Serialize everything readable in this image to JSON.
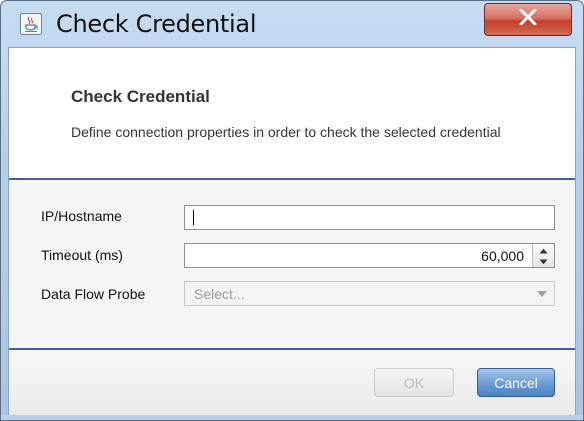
{
  "window": {
    "title": "Check Credential",
    "close_symbol": "X"
  },
  "header": {
    "title": "Check Credential",
    "description": "Define connection properties in order to check the selected credential"
  },
  "form": {
    "ip_label": "IP/Hostname",
    "ip_value": "",
    "timeout_label": "Timeout (ms)",
    "timeout_value": "60,000",
    "probe_label": "Data Flow Probe",
    "probe_placeholder": "Select..."
  },
  "buttons": {
    "ok_label": "OK",
    "ok_enabled": false,
    "cancel_label": "Cancel"
  },
  "icons": {
    "title_icon": "java-cup-icon",
    "close_icon": "close-icon",
    "spin_up_icon": "arrow-up-icon",
    "spin_down_icon": "arrow-down-icon",
    "dropdown_icon": "chevron-down-icon"
  },
  "colors": {
    "title_bar": "#b6cfea",
    "close_button": "#c2402c",
    "separator": "#3f5f96",
    "cancel_button": "#4d82c4"
  }
}
